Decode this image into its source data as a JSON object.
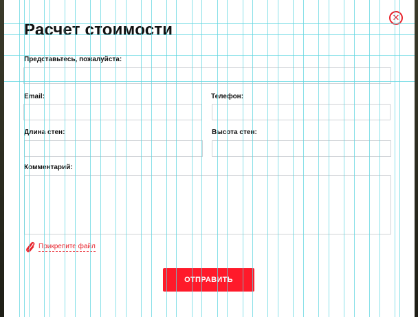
{
  "modal": {
    "title": "Расчет стоимости",
    "close_icon": "close-icon",
    "accent_color": "#ff1a2a"
  },
  "form": {
    "name": {
      "label": "Представьтесь, пожалуйста:",
      "value": ""
    },
    "email": {
      "label": "Email:",
      "value": ""
    },
    "phone": {
      "label": "Телефон:",
      "value": ""
    },
    "wall_length": {
      "label": "Длина стен:",
      "value": ""
    },
    "wall_height": {
      "label": "Высота стен:",
      "value": ""
    },
    "comment": {
      "label": "Комментарий:",
      "value": ""
    },
    "attach": {
      "icon": "paperclip-icon",
      "label": "Прикрепите файл"
    },
    "submit_label": "ОТПРАВИТЬ"
  }
}
